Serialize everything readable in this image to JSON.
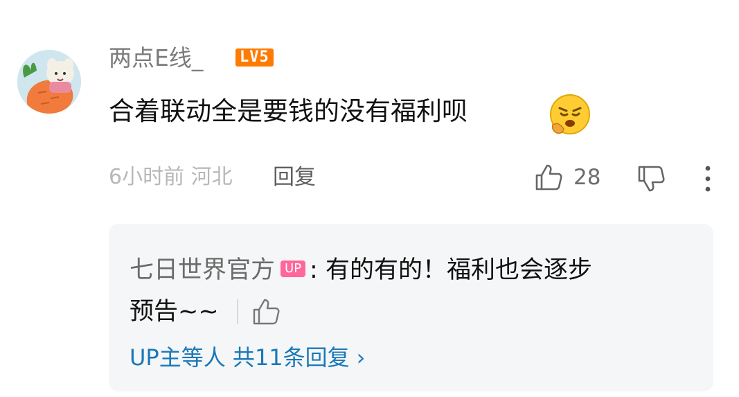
{
  "comment": {
    "username": "两点E线_",
    "level_badge": "LV5",
    "text": "合着联动全是要钱的没有福利呗",
    "emoji": "pained-face-emoji",
    "time": "6小时前",
    "location": "河北",
    "reply_label": "回复",
    "like_count": "28"
  },
  "reply": {
    "author": "七日世界官方",
    "up_badge": "UP",
    "separator": ":",
    "text_line1": "有的有的！福利也会逐步",
    "text_line2": "预告~~",
    "view_replies_label": "UP主等人 共11条回复",
    "chevron": "›"
  },
  "colors": {
    "level_badge": "#ff7a00",
    "up_badge": "#ff6699",
    "link": "#1a78b8",
    "reply_bg": "#f5f6f7"
  }
}
